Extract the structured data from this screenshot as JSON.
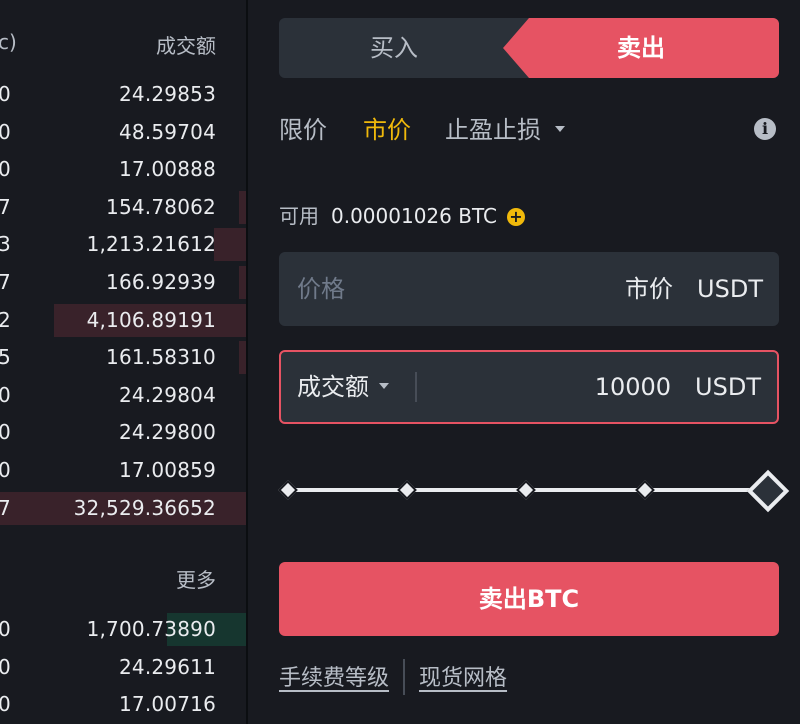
{
  "orderbook": {
    "header_left": "c)",
    "header_right": "成交额",
    "more_label": "更多",
    "sell_color": "#e65363",
    "buy_color": "#0ecb81",
    "asks": [
      {
        "pre": "0",
        "amount": "24.29853",
        "depth": 0
      },
      {
        "pre": "0",
        "amount": "48.59704",
        "depth": 0
      },
      {
        "pre": "0",
        "amount": "17.00888",
        "depth": 0
      },
      {
        "pre": "7",
        "amount": "154.78062",
        "depth": 0.03
      },
      {
        "pre": "3",
        "amount": "1,213.21612",
        "depth": 0.13
      },
      {
        "pre": "7",
        "amount": "166.92939",
        "depth": 0.03
      },
      {
        "pre": "2",
        "amount": "4,106.89191",
        "depth": 0.78
      },
      {
        "pre": "5",
        "amount": "161.58310",
        "depth": 0.03
      },
      {
        "pre": "0",
        "amount": "24.29804",
        "depth": 0
      },
      {
        "pre": "0",
        "amount": "24.29800",
        "depth": 0
      },
      {
        "pre": "0",
        "amount": "17.00859",
        "depth": 0
      },
      {
        "pre": "7",
        "amount": "32,529.36652",
        "depth": 1.0
      }
    ],
    "bids": [
      {
        "pre": "0",
        "amount": "1,700.73890",
        "depth": 0.32
      },
      {
        "pre": "0",
        "amount": "24.29611",
        "depth": 0
      },
      {
        "pre": "0",
        "amount": "17.00716",
        "depth": 0
      }
    ]
  },
  "trade": {
    "buy_label": "买入",
    "sell_label": "卖出",
    "tabs": [
      {
        "label": "限价",
        "active": false
      },
      {
        "label": "市价",
        "active": true
      },
      {
        "label": "止盈止损",
        "active": false
      }
    ],
    "available_label": "可用",
    "available_value": "0.00001026 BTC",
    "price_placeholder": "价格",
    "price_mode": "市价",
    "price_unit": "USDT",
    "total_select": "成交额",
    "total_value": "10000",
    "total_unit": "USDT",
    "slider_percent": 100,
    "sell_button": "卖出BTC",
    "link_fee": "手续费等级",
    "link_grid": "现货网格",
    "accent_color": "#f0b90b"
  }
}
